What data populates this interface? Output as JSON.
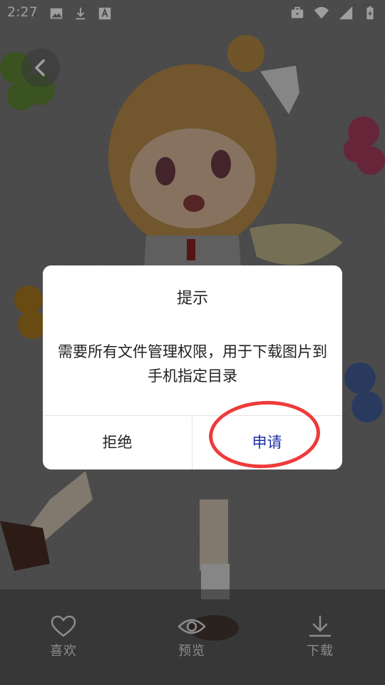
{
  "status_bar": {
    "time": "2:27",
    "left_icons": [
      "image-icon",
      "download-icon",
      "font-icon"
    ],
    "right_icons": [
      "briefcase-icon",
      "wifi-icon",
      "signal-icon",
      "battery-icon"
    ]
  },
  "dialog": {
    "title": "提示",
    "message": "需要所有文件管理权限，用于下载图片到手机指定目录",
    "reject_label": "拒绝",
    "apply_label": "申请"
  },
  "bottom_bar": {
    "like_label": "喜欢",
    "preview_label": "预览",
    "download_label": "下载"
  },
  "colors": {
    "apply_button": "#1e2fa6",
    "annotation": "#ee3b3b"
  }
}
